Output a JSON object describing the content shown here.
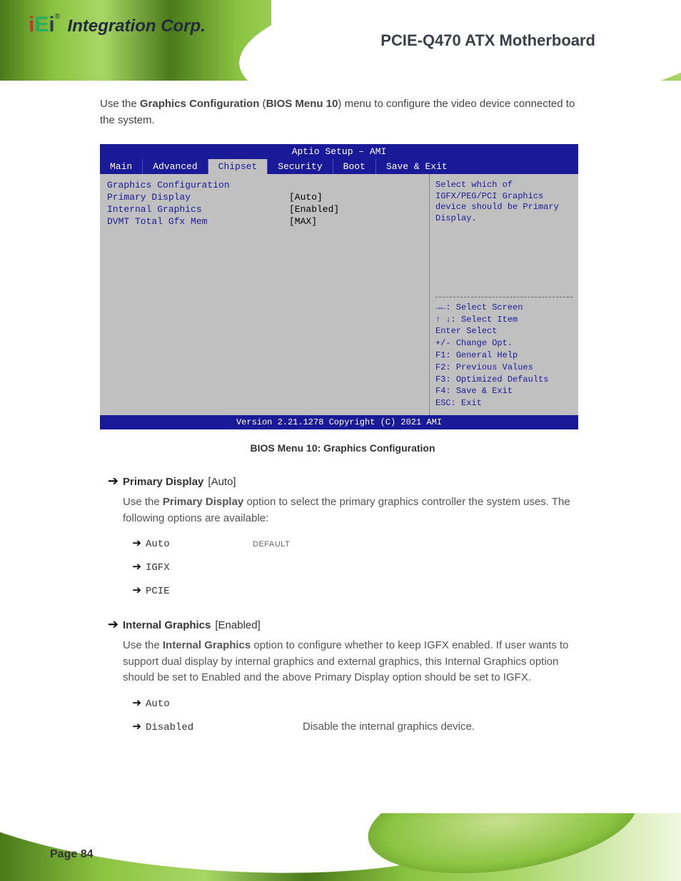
{
  "doc": {
    "title": "PCIE-Q470 ATX Motherboard",
    "page_anchor": "Page 84"
  },
  "lead": "Use the Graphics Configuration (BIOS Menu 10) menu to configure the video device connected to the system.",
  "bios": {
    "header": "Aptio Setup – AMI",
    "tabs": [
      "Main",
      "Advanced",
      "Chipset",
      "Security",
      "Boot",
      "Save & Exit"
    ],
    "active_tab": 2,
    "rows": [
      {
        "k": "Graphics Configuration",
        "v": ""
      },
      {
        "k": "Primary Display",
        "v": "[Auto]"
      },
      {
        "k": "Internal Graphics",
        "v": "[Enabled]"
      },
      {
        "k": "DVMT Total Gfx Mem",
        "v": "[MAX]"
      }
    ],
    "help_top": "Select which of IGFX/PEG/PCI Graphics device should be Primary Display.",
    "help_nav": [
      {
        "sym": "→←",
        "txt": ": Select Screen"
      },
      {
        "sym": "↑ ↓",
        "txt": ": Select Item"
      },
      {
        "sym": "Enter",
        "txt": "Select"
      },
      {
        "sym": "+/-",
        "txt": "Change Opt."
      },
      {
        "sym": "F1:",
        "txt": "General Help"
      },
      {
        "sym": "F2:",
        "txt": "Previous Values"
      },
      {
        "sym": "F3:",
        "txt": "Optimized Defaults"
      },
      {
        "sym": "F4:",
        "txt": "Save & Exit"
      },
      {
        "sym": "ESC:",
        "txt": "Exit"
      }
    ],
    "footer": "Version 2.21.1278 Copyright (C) 2021 AMI"
  },
  "caption": "BIOS Menu 10: Graphics Configuration",
  "options": [
    {
      "name": "Primary Display",
      "range": "[Auto]",
      "desc": "Use the Primary Display option to select the primary graphics controller the system uses. The following options are available:",
      "items": [
        {
          "val": "Auto",
          "def": "DEFAULT",
          "expl": ""
        },
        {
          "val": "IGFX",
          "def": "",
          "expl": ""
        },
        {
          "val": "PCIE",
          "def": "",
          "expl": ""
        }
      ]
    },
    {
      "name": "Internal Graphics",
      "range": "[Enabled]",
      "desc": "Use the Internal Graphics option to configure whether to keep IGFX enabled. If user wants to support dual display by internal graphics and external graphics, this Internal Graphics option should be set to Enabled and the above Primary Display option should be set to IGFX.",
      "items": [
        {
          "val": "Auto",
          "def": "",
          "expl": ""
        },
        {
          "val": "Disabled",
          "def": "",
          "expl": "Disable the internal graphics device."
        }
      ]
    }
  ]
}
